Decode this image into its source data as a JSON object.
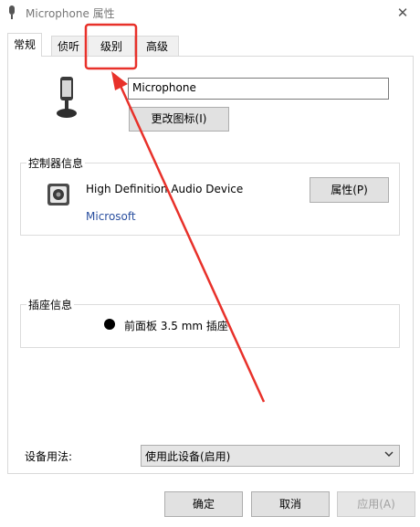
{
  "window": {
    "title": "Microphone 属性",
    "close_glyph": "✕"
  },
  "tabs": [
    {
      "label": "常规",
      "active": true
    },
    {
      "label": "侦听",
      "active": false
    },
    {
      "label": "级别",
      "active": false
    },
    {
      "label": "高级",
      "active": false
    }
  ],
  "general": {
    "device_name": "Microphone",
    "change_icon_label": "更改图标(I)",
    "controller_group": "控制器信息",
    "controller_name": "High Definition Audio Device",
    "controller_vendor": "Microsoft",
    "properties_label": "属性(P)",
    "jack_group": "插座信息",
    "jack_desc": "前面板 3.5 mm 插座",
    "usage_label": "设备用法:",
    "usage_value": "使用此设备(启用)"
  },
  "footer": {
    "ok": "确定",
    "cancel": "取消",
    "apply": "应用(A)"
  },
  "annotation_color": "#e8312a",
  "link_color": "#2a4f9f"
}
